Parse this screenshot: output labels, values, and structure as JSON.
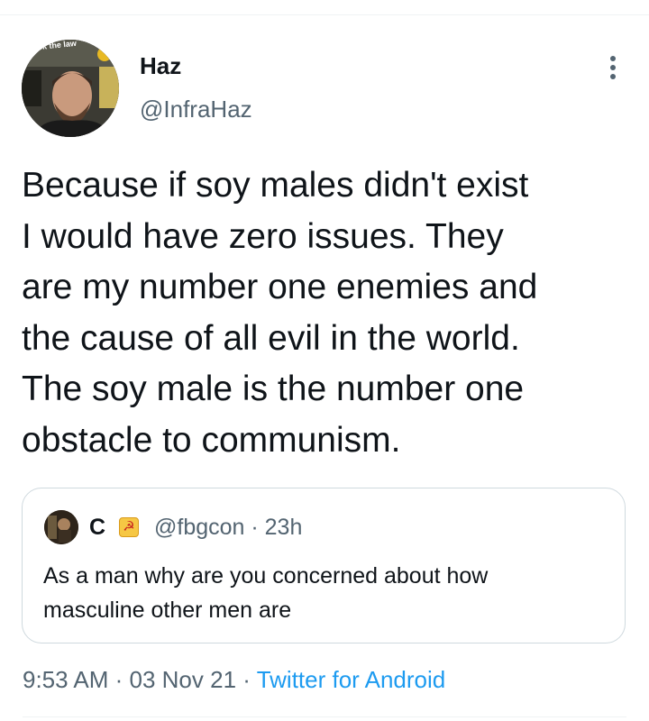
{
  "tweet": {
    "author_name": "Haz",
    "author_handle": "@InfraHaz",
    "avatar_overlay_text": "ck the law",
    "text": "Because if soy males didn't exist\nI would have zero issues. They\nare my number one enemies and\nthe cause of all evil in the world.\nThe soy male is the number one\nobstacle to communism.",
    "more_icon": "more-vertical-icon"
  },
  "quoted_tweet": {
    "author_name": "C",
    "badge_icon": "hammer-sickle-icon",
    "badge_glyph": "☭",
    "meta": "@fbgcon · 23h",
    "text": "As a man why are you concerned about how\nmasculine other men are"
  },
  "footer": {
    "time": "9:53 AM",
    "sep1": " · ",
    "date": "03 Nov 21",
    "sep2": " · ",
    "source": "Twitter for Android"
  },
  "colors": {
    "text": "#0f1419",
    "secondary": "#536471",
    "link": "#1d9bf0",
    "border": "#cfd9de"
  }
}
